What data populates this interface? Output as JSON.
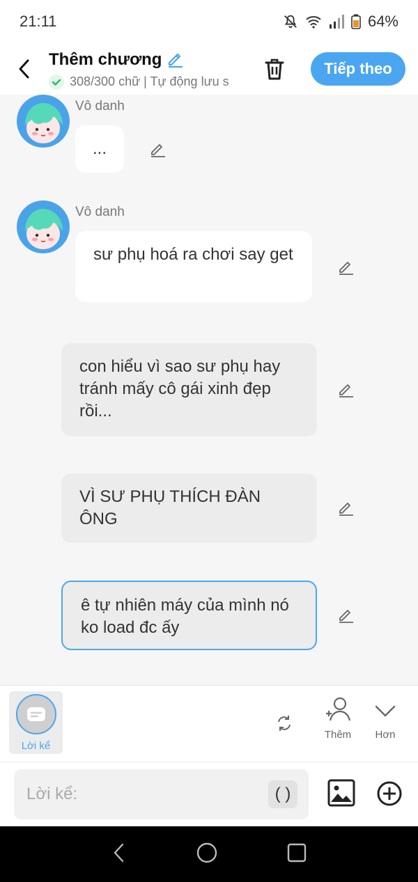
{
  "status_bar": {
    "time": "21:11",
    "battery": "64%",
    "icons": [
      "mute-bell-icon",
      "wifi-icon",
      "signal-icon",
      "battery-icon"
    ]
  },
  "header": {
    "title": "Thêm chương",
    "subtitle": "308/300 chữ | Tự động lưu s",
    "next_label": "Tiếp theo"
  },
  "messages": [
    {
      "speaker": "Vô danh",
      "text": "...",
      "style": "character"
    },
    {
      "speaker": "Vô danh",
      "text": "sư phụ hoá ra chơi say get",
      "style": "character"
    },
    {
      "speaker": "",
      "text": "con hiểu vì sao sư phụ hay tránh mấy cô gái xinh đẹp rồi...",
      "style": "narration"
    },
    {
      "speaker": "",
      "text": "VÌ SƯ PHỤ THÍCH ĐÀN ÔNG",
      "style": "narration"
    },
    {
      "speaker": "",
      "text": "ê tự nhiên máy của mình nó ko load đc ấy",
      "style": "narration-selected"
    }
  ],
  "toolbar": {
    "narration_label": "Lời kể",
    "add_label": "Thêm",
    "more_label": "Hơn"
  },
  "input": {
    "placeholder": "Lời kể:",
    "paren_label": "( )"
  },
  "colors": {
    "accent": "#4aa6f0",
    "avatar_bg": "#4aa3e8",
    "narration_bg": "#ececec"
  }
}
